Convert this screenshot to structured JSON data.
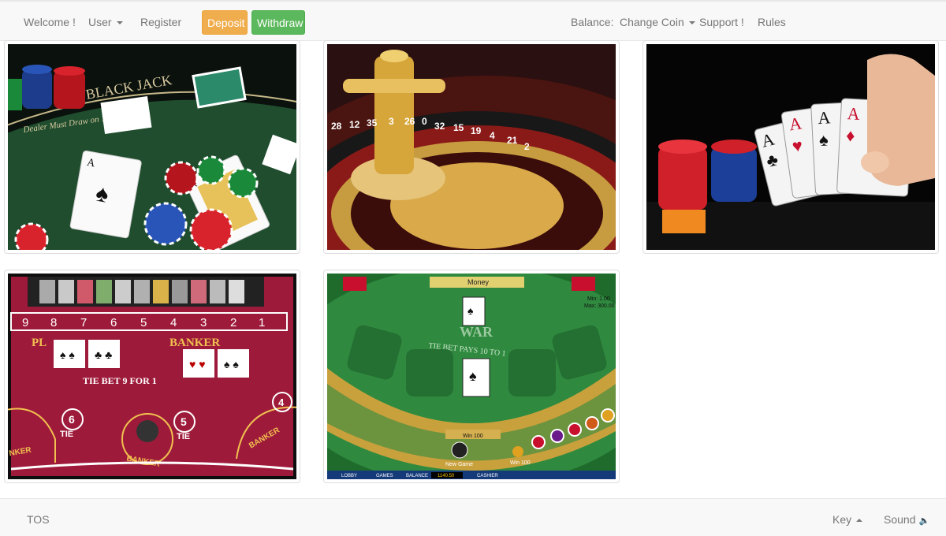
{
  "nav": {
    "welcome": "Welcome !",
    "user": "User",
    "register": "Register",
    "deposit": "Deposit",
    "withdraw": "Withdraw",
    "balance": "Balance:",
    "change_coin": "Change Coin",
    "support": "Support !",
    "rules": "Rules"
  },
  "games": {
    "blackjack": {
      "table_text": "BLACK JACK",
      "sub_text": "Dealer Must Draw on 16 and on 17"
    },
    "roulette": {
      "numbers": [
        "28",
        "12",
        "35",
        "3",
        "26",
        "0",
        "32",
        "15",
        "19",
        "4",
        "21",
        "2"
      ]
    },
    "poker": {
      "cards": [
        "A",
        "A",
        "A",
        "A"
      ]
    },
    "baccarat": {
      "player": "PL",
      "banker": "BANKER",
      "tie_bet": "TIE BET 9 FOR 1",
      "tie": "TIE",
      "tie6": "6",
      "tie5": "5",
      "tie4": "4",
      "banker_ring": "BANKER",
      "side_banker": "BANKER",
      "nker": "NKER",
      "numbers": [
        "9",
        "8",
        "7",
        "6",
        "5",
        "4",
        "3",
        "2",
        "1"
      ]
    },
    "war": {
      "money": "Money",
      "war_text": "WAR",
      "tie_text": "TIE BET PAYS 10 TO 1",
      "win": "Win 100",
      "win_small": "Win 100",
      "new_game": "New Game",
      "min": "Min: 1.00",
      "max": "Max: 300.00",
      "lobby": "LOBBY",
      "games_tab": "GAMES",
      "balance_label": "BALANCE",
      "balance_value": "1140.50",
      "cashier": "CASHIER"
    }
  },
  "footer": {
    "tos": "TOS",
    "key": "Key",
    "sound": "Sound"
  },
  "colors": {
    "deposit": "#f0ad4e",
    "withdraw": "#5cb85c",
    "felt_green": "#1f4d2e",
    "baccarat_red": "#9e1a3a",
    "war_green": "#2f8a3f"
  }
}
